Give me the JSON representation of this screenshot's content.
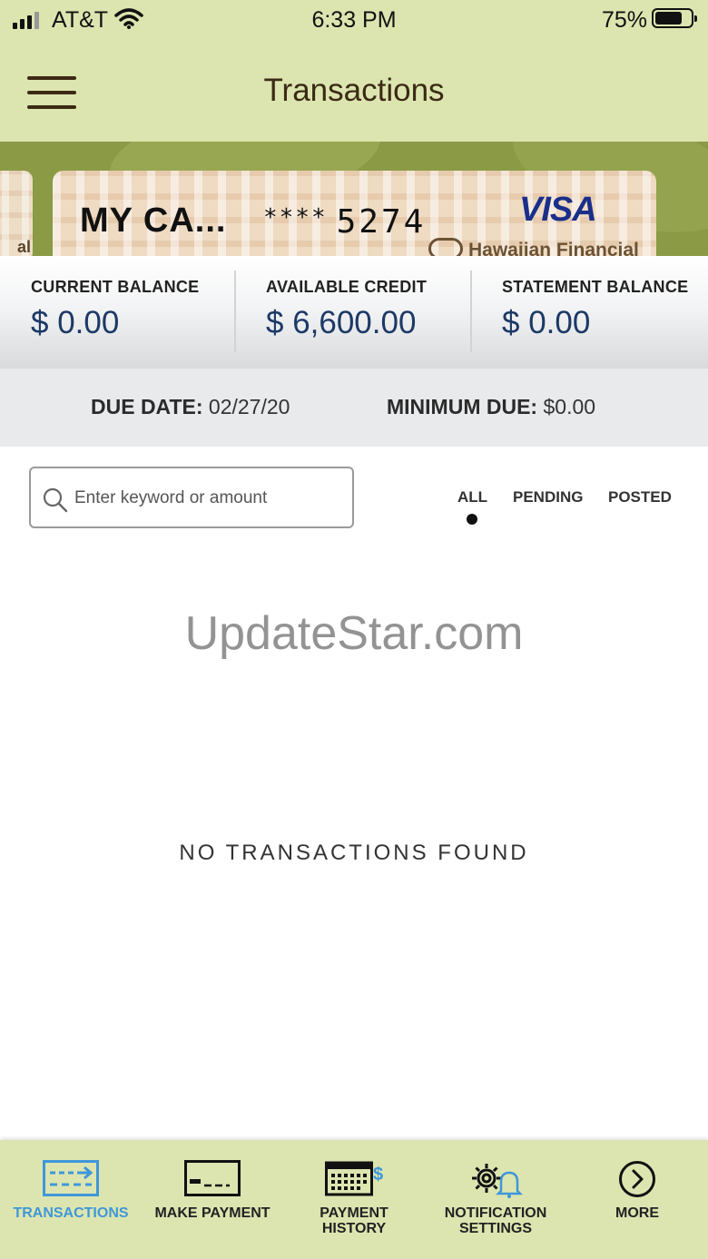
{
  "status_bar": {
    "carrier": "AT&T",
    "time": "6:33 PM",
    "battery_percent": "75%",
    "battery_level": 0.75
  },
  "header": {
    "title": "Transactions",
    "menu_icon": "hamburger-icon"
  },
  "card": {
    "name": "MY CA...",
    "masked_prefix": "****",
    "last_four": "5274",
    "network": "VISA",
    "issuer": "Hawaiian Financial",
    "previous_card_fragment": "al"
  },
  "balances": {
    "current_label": "CURRENT BALANCE",
    "current_value": "$ 0.00",
    "available_label": "AVAILABLE CREDIT",
    "available_value": "$ 6,600.00",
    "statement_label": "STATEMENT BALANCE",
    "statement_value": "$ 0.00"
  },
  "due": {
    "due_date_label": "DUE DATE:",
    "due_date_value": "02/27/20",
    "minimum_due_label": "MINIMUM DUE:",
    "minimum_due_value": "$0.00"
  },
  "search": {
    "placeholder": "Enter keyword or amount",
    "icon": "search-icon"
  },
  "filters": {
    "tabs": [
      "ALL",
      "PENDING",
      "POSTED"
    ],
    "selected": "ALL"
  },
  "watermark": "UpdateStar.com",
  "empty_message": "NO TRANSACTIONS FOUND",
  "tab_bar": {
    "items": [
      {
        "label": "TRANSACTIONS",
        "icon": "transactions-icon",
        "active": true
      },
      {
        "label": "MAKE PAYMENT",
        "icon": "card-payment-icon",
        "active": false
      },
      {
        "label": "PAYMENT\nHISTORY",
        "icon": "calendar-dollar-icon",
        "active": false
      },
      {
        "label": "NOTIFICATION\nSETTINGS",
        "icon": "gear-bell-icon",
        "active": false
      },
      {
        "label": "MORE",
        "icon": "chevron-right-circle-icon",
        "active": false
      }
    ]
  },
  "colors": {
    "header_bg": "#dce5b0",
    "balance_text": "#1c3966",
    "active_tab": "#3f97d9",
    "banner_bg": "#8a9a45"
  }
}
